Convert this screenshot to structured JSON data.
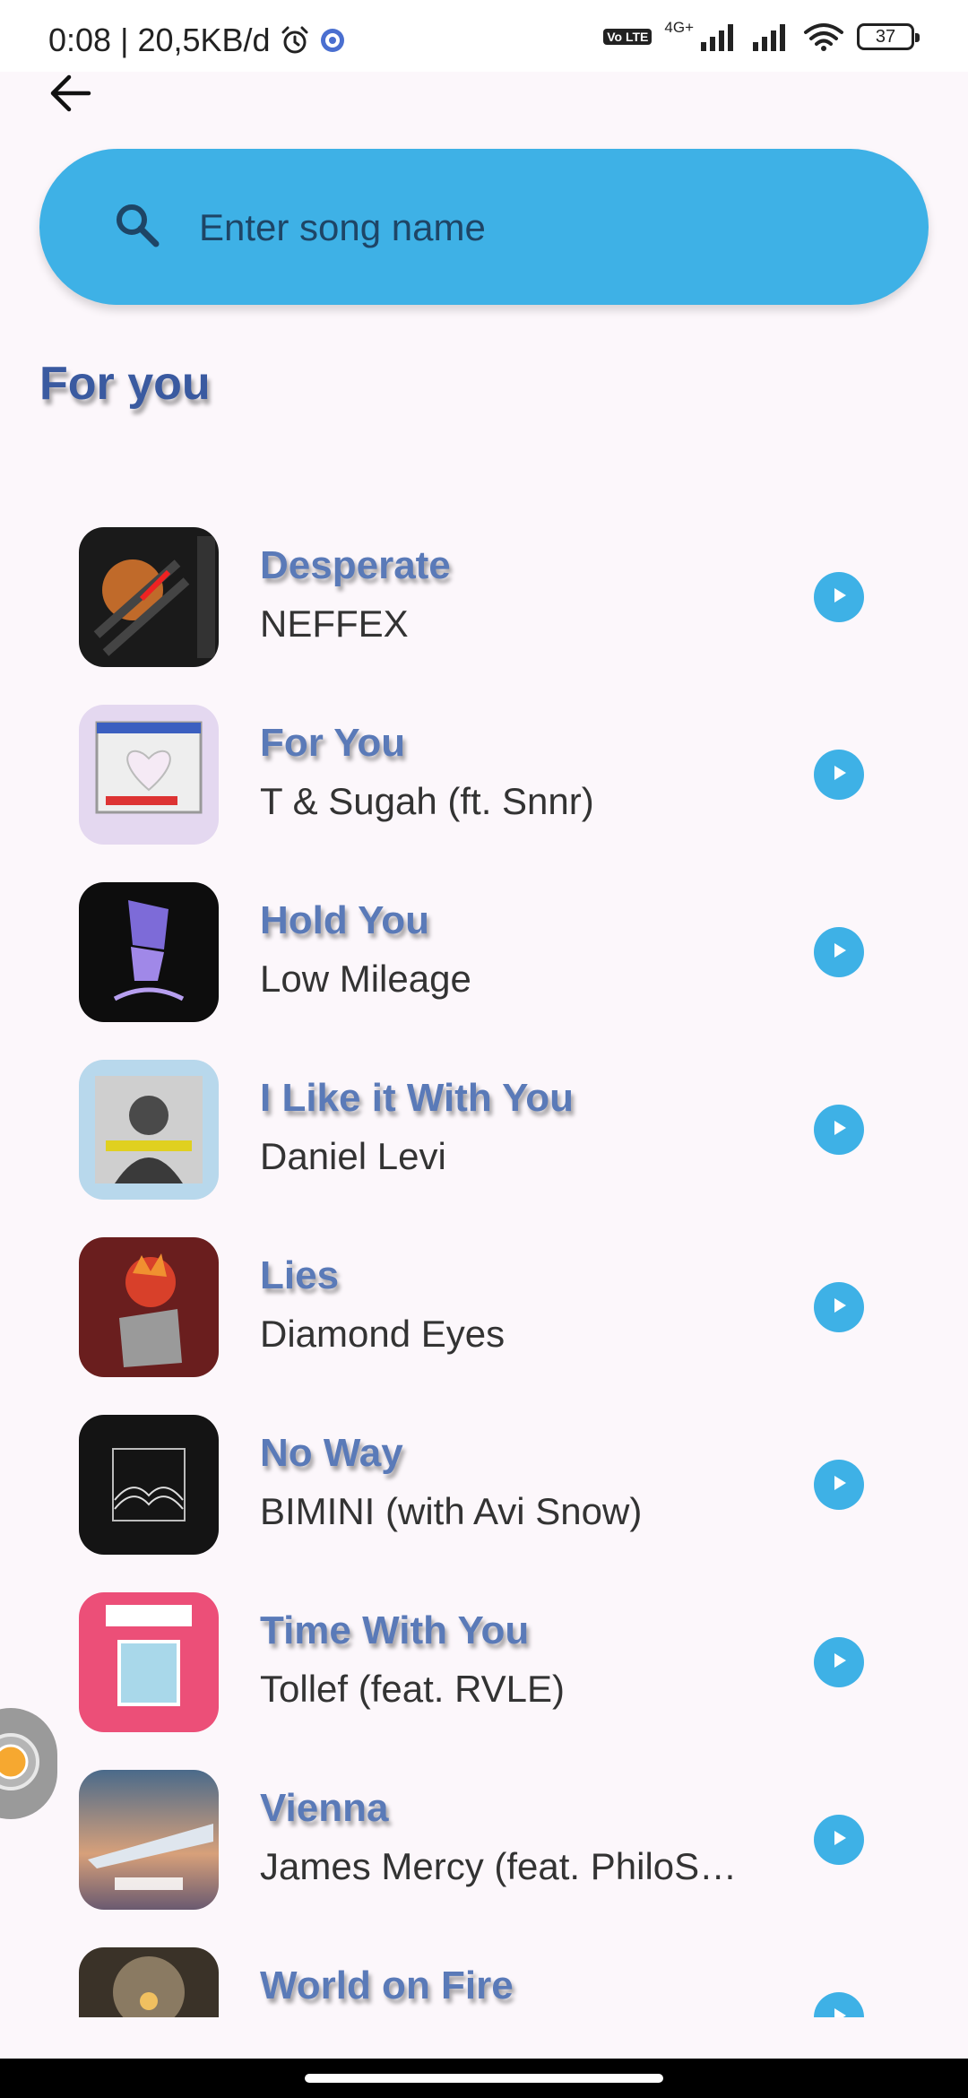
{
  "status_bar": {
    "time": "0:08",
    "data_speed": "20,5KB/d",
    "network_type": "4G+",
    "lte_label": "Vo LTE",
    "battery_level": "37"
  },
  "search": {
    "placeholder": "Enter song name",
    "value": ""
  },
  "section": {
    "title": "For you"
  },
  "songs": [
    {
      "title": "Desperate",
      "artist": "NEFFEX"
    },
    {
      "title": "For You",
      "artist": "T & Sugah (ft. Snnr)"
    },
    {
      "title": "Hold You",
      "artist": "Low Mileage"
    },
    {
      "title": "I Like it With You",
      "artist": "Daniel Levi"
    },
    {
      "title": "Lies",
      "artist": "Diamond Eyes"
    },
    {
      "title": "No Way",
      "artist": "BIMINI (with Avi Snow)"
    },
    {
      "title": "Time With You",
      "artist": "Tollef (feat. RVLE)"
    },
    {
      "title": "Vienna",
      "artist": "James Mercy (feat. PhiloS…"
    },
    {
      "title": "World on Fire",
      "artist": ""
    }
  ],
  "colors": {
    "accent": "#3eb1e6",
    "title_color": "#3a5aa0",
    "song_title_color": "#5a7ab8",
    "background": "#fcf7fb"
  },
  "icons": {
    "back": "arrow-left-icon",
    "search": "search-icon",
    "play": "play-icon",
    "alarm": "alarm-icon",
    "wifi": "wifi-icon",
    "signal": "signal-icon",
    "battery": "battery-icon"
  }
}
